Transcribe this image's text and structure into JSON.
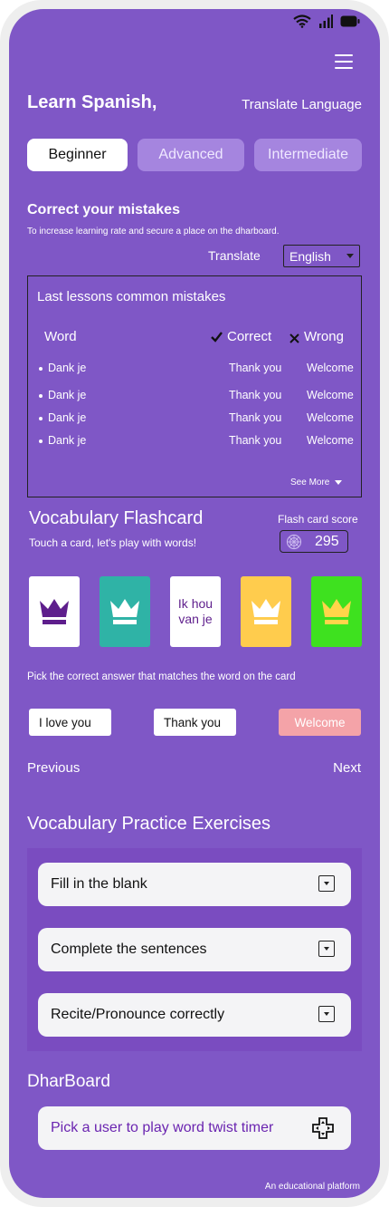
{
  "header": {
    "title": "Learn Spanish,",
    "translate_language": "Translate Language"
  },
  "levels": [
    {
      "label": "Beginner",
      "active": true
    },
    {
      "label": "Advanced",
      "active": false
    },
    {
      "label": "Intermediate",
      "active": false
    }
  ],
  "mistakes_section": {
    "title": "Correct your mistakes",
    "subtitle": "To increase learning rate and secure a place on the dharboard.",
    "translate_label": "Translate",
    "language_selected": "English",
    "box_title": "Last lessons common mistakes",
    "columns": {
      "word": "Word",
      "correct": "Correct",
      "wrong": "Wrong"
    },
    "rows": [
      {
        "word": "Dank je",
        "correct": "Thank you",
        "wrong": "Welcome"
      },
      {
        "word": "Dank je",
        "correct": "Thank you",
        "wrong": "Welcome"
      },
      {
        "word": "Dank je",
        "correct": "Thank you",
        "wrong": "Welcome"
      },
      {
        "word": "Dank je",
        "correct": "Thank you",
        "wrong": "Welcome"
      }
    ],
    "see_more": "See More"
  },
  "flashcard": {
    "title": "Vocabulary Flashcard",
    "subtitle": "Touch a card, let's play with words!",
    "score_label": "Flash card score",
    "score": "295",
    "cards": [
      {
        "type": "crown",
        "bg": "#ffffff",
        "fg": "#5e1e8c"
      },
      {
        "type": "crown",
        "bg": "#2fb3a6",
        "fg": "#ffffff"
      },
      {
        "type": "text",
        "bg": "#ffffff",
        "fg": "#5e1e8c",
        "text": "Ik hou van je"
      },
      {
        "type": "crown",
        "bg": "#ffcc4d",
        "fg": "#ffffff"
      },
      {
        "type": "crown",
        "bg": "#3ee11f",
        "fg": "#ffd54a"
      }
    ],
    "instruction": "Pick the correct answer that matches the word on the card",
    "answers": [
      {
        "label": "I love you",
        "style": "default"
      },
      {
        "label": "Thank you",
        "style": "default"
      },
      {
        "label": "Welcome",
        "style": "wrong"
      }
    ],
    "previous": "Previous",
    "next": "Next"
  },
  "practice": {
    "title": "Vocabulary Practice Exercises",
    "items": [
      "Fill in the blank",
      "Complete the sentences",
      "Recite/Pronounce correctly"
    ]
  },
  "dharboard": {
    "title": "DharBoard",
    "button": "Pick a user to play word twist timer"
  },
  "footer": "An educational platform",
  "colors": {
    "background": "#7f57c6",
    "accent_purple": "#6a24b0",
    "wrong_answer": "#f4a3a8"
  }
}
